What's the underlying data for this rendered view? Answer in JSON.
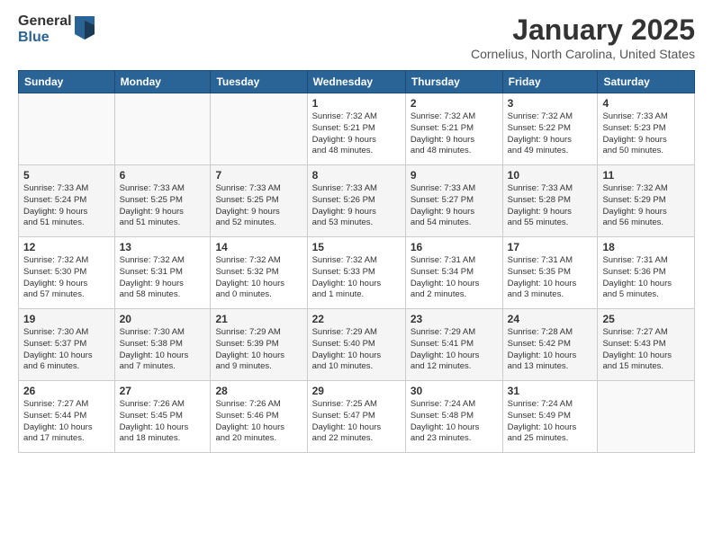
{
  "header": {
    "logo_general": "General",
    "logo_blue": "Blue",
    "month_title": "January 2025",
    "location": "Cornelius, North Carolina, United States"
  },
  "weekdays": [
    "Sunday",
    "Monday",
    "Tuesday",
    "Wednesday",
    "Thursday",
    "Friday",
    "Saturday"
  ],
  "weeks": [
    [
      {
        "day": "",
        "info": ""
      },
      {
        "day": "",
        "info": ""
      },
      {
        "day": "",
        "info": ""
      },
      {
        "day": "1",
        "info": "Sunrise: 7:32 AM\nSunset: 5:21 PM\nDaylight: 9 hours\nand 48 minutes."
      },
      {
        "day": "2",
        "info": "Sunrise: 7:32 AM\nSunset: 5:21 PM\nDaylight: 9 hours\nand 48 minutes."
      },
      {
        "day": "3",
        "info": "Sunrise: 7:32 AM\nSunset: 5:22 PM\nDaylight: 9 hours\nand 49 minutes."
      },
      {
        "day": "4",
        "info": "Sunrise: 7:33 AM\nSunset: 5:23 PM\nDaylight: 9 hours\nand 50 minutes."
      }
    ],
    [
      {
        "day": "5",
        "info": "Sunrise: 7:33 AM\nSunset: 5:24 PM\nDaylight: 9 hours\nand 51 minutes."
      },
      {
        "day": "6",
        "info": "Sunrise: 7:33 AM\nSunset: 5:25 PM\nDaylight: 9 hours\nand 51 minutes."
      },
      {
        "day": "7",
        "info": "Sunrise: 7:33 AM\nSunset: 5:25 PM\nDaylight: 9 hours\nand 52 minutes."
      },
      {
        "day": "8",
        "info": "Sunrise: 7:33 AM\nSunset: 5:26 PM\nDaylight: 9 hours\nand 53 minutes."
      },
      {
        "day": "9",
        "info": "Sunrise: 7:33 AM\nSunset: 5:27 PM\nDaylight: 9 hours\nand 54 minutes."
      },
      {
        "day": "10",
        "info": "Sunrise: 7:33 AM\nSunset: 5:28 PM\nDaylight: 9 hours\nand 55 minutes."
      },
      {
        "day": "11",
        "info": "Sunrise: 7:32 AM\nSunset: 5:29 PM\nDaylight: 9 hours\nand 56 minutes."
      }
    ],
    [
      {
        "day": "12",
        "info": "Sunrise: 7:32 AM\nSunset: 5:30 PM\nDaylight: 9 hours\nand 57 minutes."
      },
      {
        "day": "13",
        "info": "Sunrise: 7:32 AM\nSunset: 5:31 PM\nDaylight: 9 hours\nand 58 minutes."
      },
      {
        "day": "14",
        "info": "Sunrise: 7:32 AM\nSunset: 5:32 PM\nDaylight: 10 hours\nand 0 minutes."
      },
      {
        "day": "15",
        "info": "Sunrise: 7:32 AM\nSunset: 5:33 PM\nDaylight: 10 hours\nand 1 minute."
      },
      {
        "day": "16",
        "info": "Sunrise: 7:31 AM\nSunset: 5:34 PM\nDaylight: 10 hours\nand 2 minutes."
      },
      {
        "day": "17",
        "info": "Sunrise: 7:31 AM\nSunset: 5:35 PM\nDaylight: 10 hours\nand 3 minutes."
      },
      {
        "day": "18",
        "info": "Sunrise: 7:31 AM\nSunset: 5:36 PM\nDaylight: 10 hours\nand 5 minutes."
      }
    ],
    [
      {
        "day": "19",
        "info": "Sunrise: 7:30 AM\nSunset: 5:37 PM\nDaylight: 10 hours\nand 6 minutes."
      },
      {
        "day": "20",
        "info": "Sunrise: 7:30 AM\nSunset: 5:38 PM\nDaylight: 10 hours\nand 7 minutes."
      },
      {
        "day": "21",
        "info": "Sunrise: 7:29 AM\nSunset: 5:39 PM\nDaylight: 10 hours\nand 9 minutes."
      },
      {
        "day": "22",
        "info": "Sunrise: 7:29 AM\nSunset: 5:40 PM\nDaylight: 10 hours\nand 10 minutes."
      },
      {
        "day": "23",
        "info": "Sunrise: 7:29 AM\nSunset: 5:41 PM\nDaylight: 10 hours\nand 12 minutes."
      },
      {
        "day": "24",
        "info": "Sunrise: 7:28 AM\nSunset: 5:42 PM\nDaylight: 10 hours\nand 13 minutes."
      },
      {
        "day": "25",
        "info": "Sunrise: 7:27 AM\nSunset: 5:43 PM\nDaylight: 10 hours\nand 15 minutes."
      }
    ],
    [
      {
        "day": "26",
        "info": "Sunrise: 7:27 AM\nSunset: 5:44 PM\nDaylight: 10 hours\nand 17 minutes."
      },
      {
        "day": "27",
        "info": "Sunrise: 7:26 AM\nSunset: 5:45 PM\nDaylight: 10 hours\nand 18 minutes."
      },
      {
        "day": "28",
        "info": "Sunrise: 7:26 AM\nSunset: 5:46 PM\nDaylight: 10 hours\nand 20 minutes."
      },
      {
        "day": "29",
        "info": "Sunrise: 7:25 AM\nSunset: 5:47 PM\nDaylight: 10 hours\nand 22 minutes."
      },
      {
        "day": "30",
        "info": "Sunrise: 7:24 AM\nSunset: 5:48 PM\nDaylight: 10 hours\nand 23 minutes."
      },
      {
        "day": "31",
        "info": "Sunrise: 7:24 AM\nSunset: 5:49 PM\nDaylight: 10 hours\nand 25 minutes."
      },
      {
        "day": "",
        "info": ""
      }
    ]
  ]
}
